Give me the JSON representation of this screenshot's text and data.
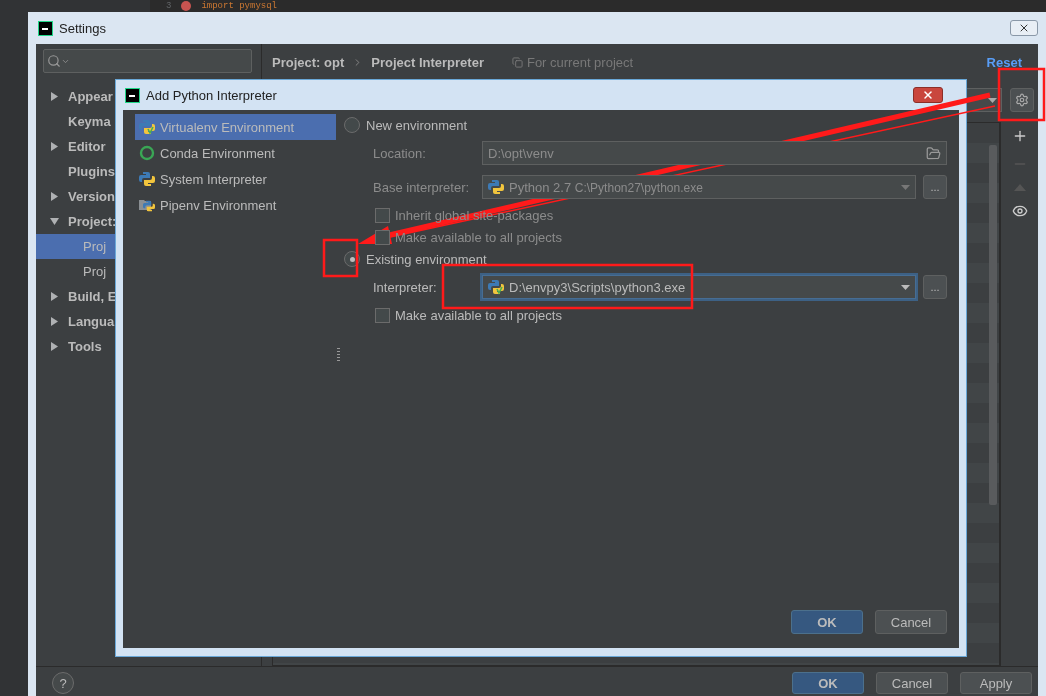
{
  "editor": {
    "line_number": "3",
    "code": "import pymysql",
    "breakpoint": true
  },
  "settings": {
    "title": "Settings",
    "tree": [
      {
        "label": "Appear",
        "expanded": false,
        "selected": false
      },
      {
        "label": "Keyma",
        "selected": false
      },
      {
        "label": "Editor",
        "expanded": false,
        "selected": false
      },
      {
        "label": "Plugins",
        "selected": false
      },
      {
        "label": "Version",
        "expanded": false,
        "selected": false
      },
      {
        "label": "Project:",
        "expanded": true,
        "selected": false,
        "children": [
          {
            "label": "Proj",
            "selected": true
          },
          {
            "label": "Proj",
            "selected": false
          }
        ]
      },
      {
        "label": "Build, E",
        "expanded": false,
        "selected": false
      },
      {
        "label": "Langua",
        "expanded": false,
        "selected": false
      },
      {
        "label": "Tools",
        "expanded": false,
        "selected": false
      }
    ],
    "breadcrumb": [
      "Project: opt",
      "Project Interpreter"
    ],
    "scope": "For current project",
    "reset": "Reset",
    "help": "?",
    "buttons": [
      {
        "label": "OK",
        "kind": "primary"
      },
      {
        "label": "Cancel",
        "kind": "default"
      },
      {
        "label": "Apply",
        "kind": "default"
      }
    ]
  },
  "dialog": {
    "title": "Add Python Interpreter",
    "env_types": [
      {
        "label": "Virtualenv Environment",
        "kind": "virtualenv",
        "selected": true
      },
      {
        "label": "Conda Environment",
        "kind": "conda",
        "selected": false
      },
      {
        "label": "System Interpreter",
        "kind": "system",
        "selected": false
      },
      {
        "label": "Pipenv Environment",
        "kind": "pipenv",
        "selected": false
      }
    ],
    "new_environment": {
      "label": "New environment",
      "selected": false,
      "location": {
        "label": "Location:",
        "value": "D:\\opt\\venv"
      },
      "base_interpreter": {
        "label": "Base interpreter:",
        "version": "Python 2.7",
        "path": "C:\\Python27\\python.exe",
        "browse": "..."
      },
      "inherit": {
        "label": "Inherit global site-packages",
        "checked": false
      },
      "make_available": {
        "label": "Make available to all projects",
        "checked": false
      }
    },
    "existing_environment": {
      "label": "Existing environment",
      "selected": true,
      "interpreter": {
        "label": "Interpreter:",
        "value": "D:\\envpy3\\Scripts\\python3.exe",
        "browse": "..."
      },
      "make_available": {
        "label": "Make available to all projects",
        "checked": false
      }
    },
    "buttons": [
      {
        "label": "OK",
        "kind": "primary"
      },
      {
        "label": "Cancel",
        "kind": "default"
      }
    ]
  }
}
